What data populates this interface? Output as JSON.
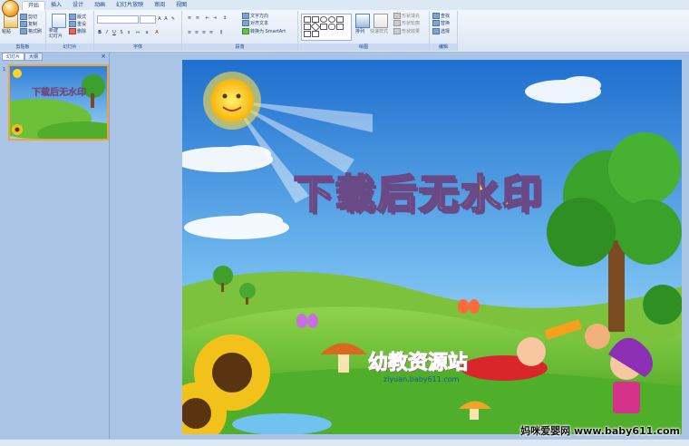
{
  "ribbon": {
    "tabs": [
      "开始",
      "插入",
      "设计",
      "动画",
      "幻灯片放映",
      "审阅",
      "视图"
    ],
    "clipboard": {
      "paste": "粘贴",
      "cut": "剪切",
      "copy": "复制",
      "format_painter": "格式刷",
      "label": "剪贴板"
    },
    "slides": {
      "new_slide": "新建\n幻灯片",
      "layout": "版式",
      "reset": "重设",
      "delete": "删除",
      "label": "幻灯片"
    },
    "font": {
      "label": "字体"
    },
    "paragraph": {
      "text_direction": "文字方向",
      "align_text": "对齐文本",
      "smartart": "转换为 SmartArt",
      "label": "段落"
    },
    "drawing": {
      "arrange": "排列",
      "quick_styles": "快速样式",
      "shape_fill": "形状填充",
      "shape_outline": "形状轮廓",
      "shape_effects": "形状效果",
      "label": "绘图"
    },
    "editing": {
      "find": "查找",
      "replace": "替换",
      "select": "选择",
      "label": "编辑"
    }
  },
  "left_pane": {
    "tab_slides": "幻灯片",
    "tab_outline": "大纲",
    "close": "×",
    "slide_number": "1",
    "thumb_title": "下载后无水印"
  },
  "slide": {
    "title": "下载后无水印",
    "logo_text": "幼教资源站",
    "logo_url": "ziyuan.baby611.com"
  },
  "watermark": "妈咪爱婴网 www.baby611.com",
  "colors": {
    "sky_top": "#2f7fd8",
    "grass": "#55b52a",
    "title_fill": "#f3f01c",
    "title_stroke": "#6a4a86",
    "accent": "#f1a33a"
  }
}
